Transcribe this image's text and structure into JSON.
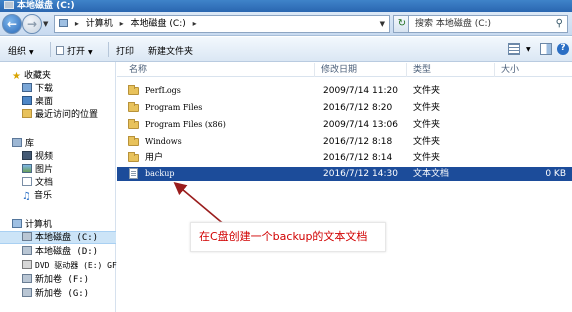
{
  "window": {
    "title": "本地磁盘 (C:)"
  },
  "address": {
    "crumbs": [
      "计算机",
      "本地磁盘 (C:)"
    ],
    "search_placeholder": "搜索 本地磁盘 (C:)"
  },
  "toolbar": {
    "organize": "组织",
    "open": "打开",
    "print": "打印",
    "new_folder": "新建文件夹"
  },
  "nav": {
    "favorites": {
      "label": "收藏夹",
      "items": [
        "下载",
        "桌面",
        "最近访问的位置"
      ]
    },
    "libraries": {
      "label": "库",
      "items": [
        "视频",
        "图片",
        "文档",
        "音乐"
      ]
    },
    "computer": {
      "label": "计算机",
      "items": [
        "本地磁盘 (C:)",
        "本地磁盘 (D:)",
        "DVD 驱动器 (E:) GF",
        "新加卷 (F:)",
        "新加卷 (G:)"
      ]
    }
  },
  "columns": [
    "名称",
    "修改日期",
    "类型",
    "大小"
  ],
  "files": [
    {
      "name": "PerfLogs",
      "date": "2009/7/14 11:20",
      "type": "文件夹",
      "size": "",
      "kind": "folder"
    },
    {
      "name": "Program Files",
      "date": "2016/7/12 8:20",
      "type": "文件夹",
      "size": "",
      "kind": "folder"
    },
    {
      "name": "Program Files (x86)",
      "date": "2009/7/14 13:06",
      "type": "文件夹",
      "size": "",
      "kind": "folder"
    },
    {
      "name": "Windows",
      "date": "2016/7/12 8:18",
      "type": "文件夹",
      "size": "",
      "kind": "folder"
    },
    {
      "name": "用户",
      "date": "2016/7/12 8:14",
      "type": "文件夹",
      "size": "",
      "kind": "folder"
    },
    {
      "name": "backup",
      "date": "2016/7/12 14:30",
      "type": "文本文档",
      "size": "0 KB",
      "kind": "text"
    }
  ],
  "annotation": {
    "text": "在C盘创建一个backup的文本文档"
  },
  "colors": {
    "accent": "#1c4c9a",
    "annotation": "#d10000",
    "titlebar": "#2a66b0"
  }
}
